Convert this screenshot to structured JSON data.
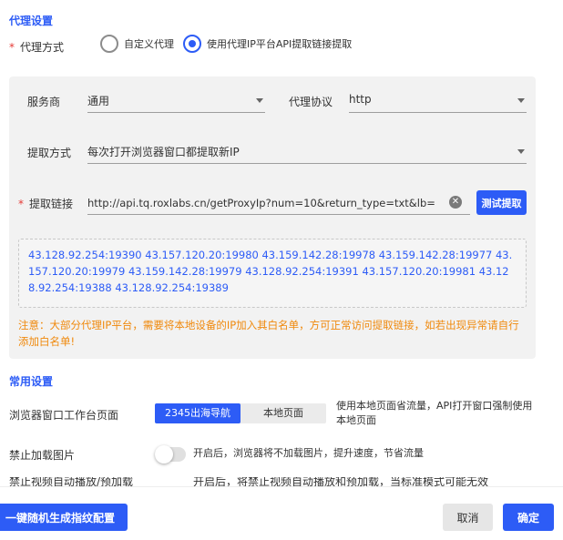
{
  "proxy": {
    "section_title": "代理设置",
    "required_mark": "*",
    "method_label": "代理方式",
    "options": [
      {
        "label": "自定义代理",
        "checked": false
      },
      {
        "label": "使用代理IP平台API提取链接提取",
        "checked": true
      }
    ],
    "provider_label": "服务商",
    "provider_value": "通用",
    "protocol_label": "代理协议",
    "protocol_value": "http",
    "extract_method_label": "提取方式",
    "extract_method_value": "每次打开浏览器窗口都提取新IP",
    "link_label": "提取链接",
    "link_value": "http://api.tq.roxlabs.cn/getProxyIp?num=10&return_type=txt&lb=",
    "test_button": "测试提取",
    "ip_list": "43.128.92.254:19390 43.157.120.20:19980 43.159.142.28:19978 43.159.142.28:19977 43.157.120.20:19979 43.159.142.28:19979 43.128.92.254:19391 43.157.120.20:19981 43.128.92.254:19388 43.128.92.254:19389",
    "warning": "注意：大部分代理IP平台，需要将本地设备的IP加入其白名单，方可正常访问提取链接，如若出现异常请自行添加白名单!"
  },
  "common": {
    "section_title": "常用设置",
    "workbench_label": "浏览器窗口工作台页面",
    "workbench_options": [
      "2345出海导航",
      "本地页面"
    ],
    "workbench_active": 0,
    "workbench_note": "使用本地页面省流量，API打开窗口强制使用本地页面",
    "disable_images_label": "禁止加载图片",
    "disable_images_note": "开启后，浏览器将不加载图片，提升速度，节省流量",
    "disable_images_on": false,
    "cutoff_label": "禁止视频自动播放/预加载",
    "cutoff_note": "开启后，将禁止视频自动播放和预加载，当标准模式可能无效"
  },
  "footer": {
    "generate_button": "一键随机生成指纹配置",
    "cancel_button": "取消",
    "confirm_button": "确定"
  },
  "colors": {
    "accent": "#2d5cf6",
    "warning": "#f0890c",
    "required": "#e53935"
  }
}
